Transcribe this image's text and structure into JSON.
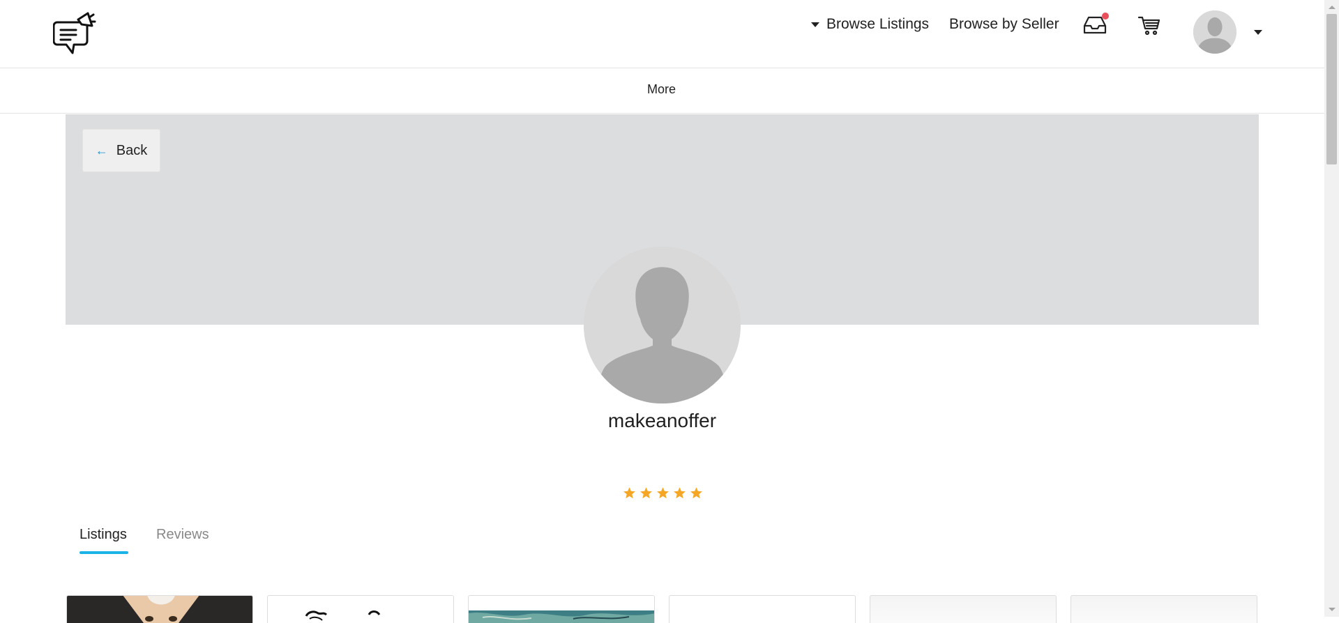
{
  "header": {
    "logo_icon": "megaphone-chat-logo",
    "browse_listings_label": "Browse Listings",
    "browse_by_seller_label": "Browse by Seller",
    "inbox_icon": "inbox-icon",
    "cart_icon": "cart-icon",
    "avatar_icon": "user-silhouette-icon",
    "notification_color": "#e8505b"
  },
  "subnav": {
    "more_label": "More"
  },
  "banner": {
    "back_label": "Back",
    "back_icon": "arrow-left-icon",
    "accent_color": "#1a8fd1"
  },
  "profile": {
    "username": "makeanoffer",
    "rating": 5,
    "rating_max": 5,
    "star_color": "#f5a623"
  },
  "tabs": [
    {
      "label": "Listings",
      "active": true
    },
    {
      "label": "Reviews",
      "active": false
    }
  ],
  "tab_accent_color": "#19b3e6",
  "listings": [
    {
      "thumbnail": "cat-photo"
    },
    {
      "thumbnail": "black-white-illustration"
    },
    {
      "thumbnail": "teal-abstract-painting"
    },
    {
      "thumbnail": "blank"
    },
    {
      "thumbnail": "placeholder"
    },
    {
      "thumbnail": "placeholder"
    }
  ]
}
